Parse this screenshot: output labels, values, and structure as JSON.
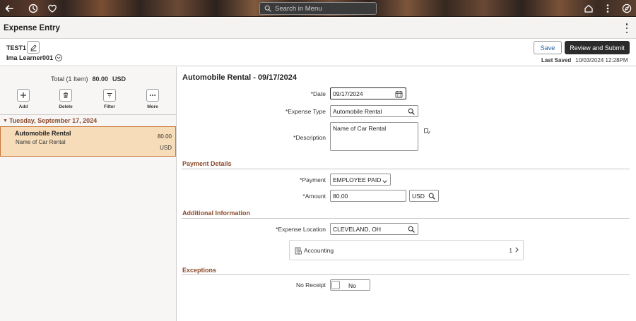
{
  "topbar": {
    "search_placeholder": "Search in Menu"
  },
  "header": {
    "title": "Expense Entry"
  },
  "report": {
    "id": "TEST1",
    "user": "Ima Learner001",
    "save_label": "Save",
    "submit_label": "Review and Submit",
    "last_saved_label": "Last Saved",
    "last_saved_value": "10/03/2024 12:28PM"
  },
  "left": {
    "total_label": "Total (1 Item)",
    "total_amount": "80.00",
    "total_currency": "USD",
    "tools": [
      {
        "label": "Add"
      },
      {
        "label": "Delete"
      },
      {
        "label": "Filter"
      },
      {
        "label": "More"
      }
    ],
    "group_date": "Tuesday, September 17, 2024",
    "item": {
      "title": "Automobile Rental",
      "description": "Name of Car Rental",
      "amount": "80.00",
      "currency": "USD"
    }
  },
  "detail": {
    "title": "Automobile Rental - 09/17/2024",
    "date_label": "*Date",
    "date_value": "09/17/2024",
    "expense_type_label": "*Expense Type",
    "expense_type_value": "Automobile Rental",
    "description_label": "*Description",
    "description_value": "Name of Car Rental",
    "payment_section": "Payment Details",
    "payment_label": "*Payment",
    "payment_value": "EMPLOYEE PAID",
    "amount_label": "*Amount",
    "amount_value": "80.00",
    "currency_value": "USD",
    "additional_section": "Additional Information",
    "location_label": "*Expense Location",
    "location_value": "CLEVELAND, OH",
    "accounting_label": "Accounting",
    "accounting_count": "1",
    "exceptions_section": "Exceptions",
    "no_receipt_label": "No Receipt",
    "no_receipt_value": "No"
  }
}
